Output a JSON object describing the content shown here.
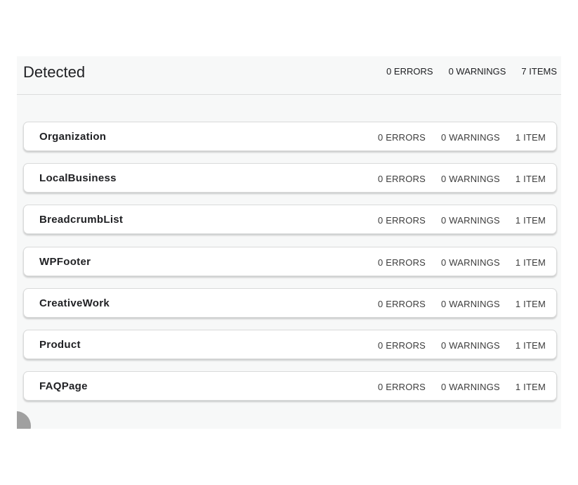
{
  "header": {
    "title": "Detected",
    "errors": "0 ERRORS",
    "warnings": "0 WARNINGS",
    "items": "7 ITEMS"
  },
  "rows": [
    {
      "name": "Organization",
      "errors": "0 ERRORS",
      "warnings": "0 WARNINGS",
      "items": "1 ITEM"
    },
    {
      "name": "LocalBusiness",
      "errors": "0 ERRORS",
      "warnings": "0 WARNINGS",
      "items": "1 ITEM"
    },
    {
      "name": "BreadcrumbList",
      "errors": "0 ERRORS",
      "warnings": "0 WARNINGS",
      "items": "1 ITEM"
    },
    {
      "name": "WPFooter",
      "errors": "0 ERRORS",
      "warnings": "0 WARNINGS",
      "items": "1 ITEM"
    },
    {
      "name": "CreativeWork",
      "errors": "0 ERRORS",
      "warnings": "0 WARNINGS",
      "items": "1 ITEM"
    },
    {
      "name": "Product",
      "errors": "0 ERRORS",
      "warnings": "0 WARNINGS",
      "items": "1 ITEM"
    },
    {
      "name": "FAQPage",
      "errors": "0 ERRORS",
      "warnings": "0 WARNINGS",
      "items": "1 ITEM"
    }
  ]
}
